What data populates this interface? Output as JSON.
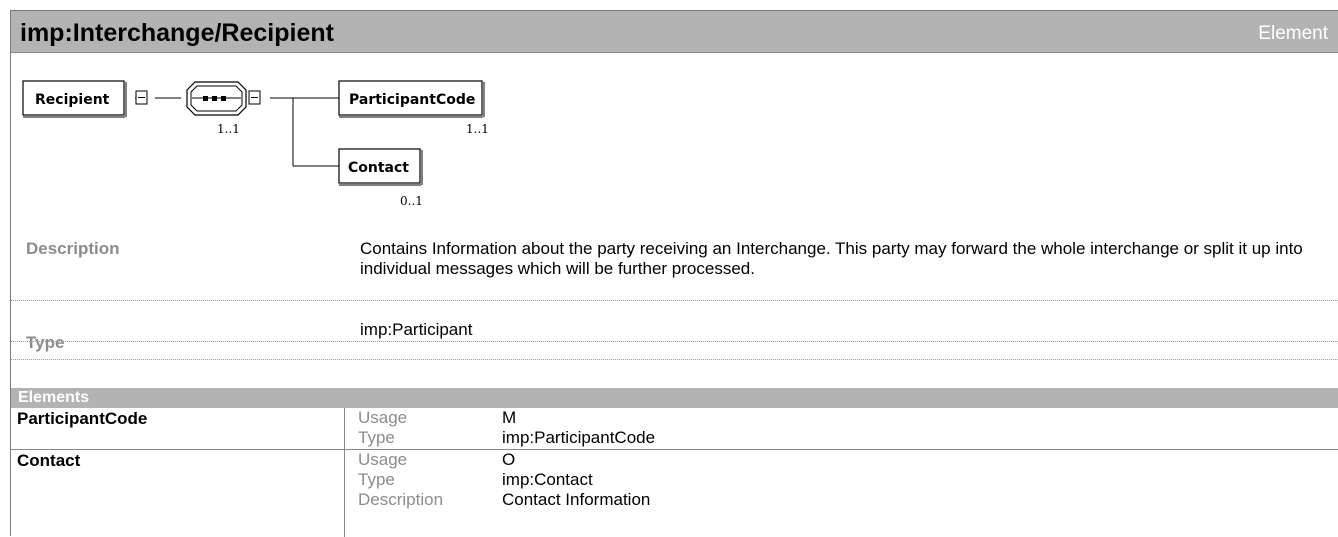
{
  "header": {
    "title": "imp:Interchange/Recipient",
    "kind": "Element"
  },
  "diagram": {
    "root": {
      "name": "Recipient"
    },
    "sequence": {
      "symbol": "▪▪▪",
      "cardinality": "1..1"
    },
    "children": [
      {
        "name": "ParticipantCode",
        "cardinality": "1..1"
      },
      {
        "name": "Contact",
        "cardinality": "0..1"
      }
    ]
  },
  "properties": {
    "description_label": "Description",
    "description_text": "Contains Information about the party receiving an Interchange. This party may forward the whole interchange or split it up into individual messages which will be further processed.",
    "type_label": "Type",
    "type_value": "imp:Participant"
  },
  "elements": {
    "heading": "Elements",
    "rows": [
      {
        "name": "ParticipantCode",
        "usage_label": "Usage",
        "usage": "M",
        "type_label": "Type",
        "type": "imp:ParticipantCode"
      },
      {
        "name": "Contact",
        "usage_label": "Usage",
        "usage": "O",
        "type_label": "Type",
        "type": "imp:Contact",
        "description_label": "Description",
        "description": "Contact Information"
      }
    ]
  }
}
